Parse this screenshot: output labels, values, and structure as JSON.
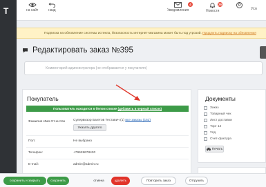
{
  "sidebar": {
    "logo_letter": "T"
  },
  "topbar": {
    "view_site_label": "на сайт",
    "undo_label": "назд",
    "notifications_label": "Уведомления",
    "notifications_count": "4",
    "news_label": "Новости",
    "news_count": "26",
    "user_label": "Усп"
  },
  "banner": {
    "text": "Подписка на обновление системы истекла, безопасность интернет-магазина может быть под угрозой.",
    "link": "Продлить подписку на обновления"
  },
  "page": {
    "title": "Редактировать заказ №395",
    "comment_placeholder": "Комментарий администратора (не отображается у покупателя)"
  },
  "customer": {
    "title": "Покупатель",
    "whitelist_text": "Пользователь находится в белом списке",
    "whitelist_link": "(добавить в черный список)",
    "fio_label": "Фамилия Имя Отчество",
    "fio_value": "Супервизор Багетов Теставич (1)",
    "all_orders_link": "все заказы (152)",
    "specify_other_button": "Указать другого",
    "sex_label": "Пол:",
    "sex_value": "Не выбрано",
    "phone_label": "Телефон:",
    "phone_value": "+79628678430",
    "email_label": "E-mail:",
    "email_value": "admin@admin.ru"
  },
  "documents": {
    "title": "Документы",
    "items": [
      {
        "label": "Заказ"
      },
      {
        "label": "Товарный чек"
      },
      {
        "label": "Лист доставки"
      },
      {
        "label": "Торг 12"
      },
      {
        "label": "Упд"
      },
      {
        "label": "Счет-фактура"
      }
    ],
    "print_button": "Печать"
  },
  "actions": {
    "save_close": "сохранить и закрыть",
    "save": "сохранить",
    "cancel": "отмена",
    "delete": "удалить",
    "repeat_order": "Повторить заказ",
    "send": "Отгрузить"
  },
  "colors": {
    "accent_green": "#3d9b48",
    "danger_red": "#e1342a",
    "banner_bg": "#fff2c6",
    "sidebar_bg": "#2f3236",
    "badge_red": "#e64a3c",
    "annotation_arrow": "#e0382b"
  }
}
